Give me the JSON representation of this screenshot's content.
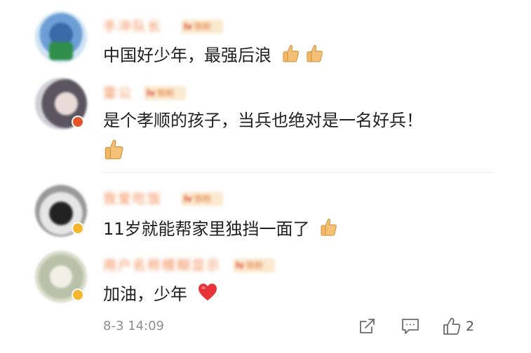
{
  "comments": [
    {
      "username": "手冲队长",
      "badge_level": "lv",
      "badge_text": "铁粉",
      "text": "中国好少年，最强后浪",
      "emojis": [
        "thumbs-up-icon",
        "thumbs-up-icon"
      ]
    },
    {
      "username": "雷公",
      "badge_level": "lv",
      "badge_text": "铁粉",
      "text": "是个孝顺的孩子，当兵也绝对是一名好兵！",
      "emojis": [
        "thumbs-up-icon"
      ]
    },
    {
      "username": "我爱吃饭",
      "badge_level": "lv",
      "badge_text": "铁粉",
      "text": "11岁就能帮家里独挡一面了",
      "emojis": [
        "thumbs-up-icon"
      ]
    },
    {
      "username": "用户名称模糊显示",
      "badge_level": "lv",
      "badge_text": "铁粉",
      "text": "加油，少年",
      "emojis": [
        "heart-icon"
      ]
    }
  ],
  "footer": {
    "timestamp": "8-3 14:09",
    "like_count": "2",
    "share_icon": "share-icon",
    "comment_icon": "comment-icon",
    "like_icon": "like-icon"
  },
  "colors": {
    "username": "#f28b54",
    "text": "#1f1f1f",
    "meta": "#8e8e8e",
    "heart": "#e8333a",
    "thumb": "#f5c177"
  }
}
